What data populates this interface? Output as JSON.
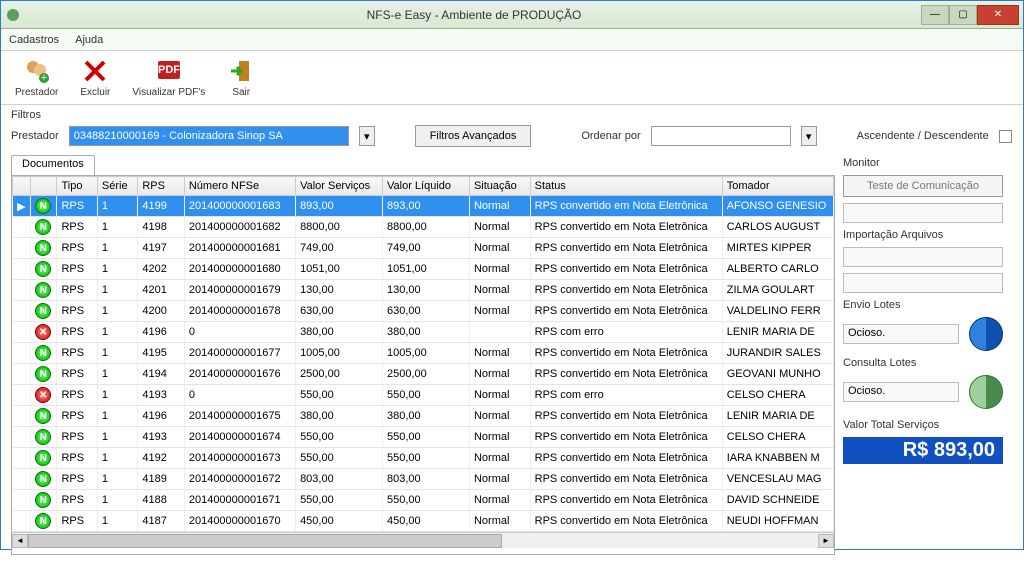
{
  "window": {
    "title": "NFS-e Easy - Ambiente de PRODUÇÃO"
  },
  "menu": {
    "cadastros": "Cadastros",
    "ajuda": "Ajuda"
  },
  "toolbar": {
    "prestador": "Prestador",
    "excluir": "Excluir",
    "visualizar": "Visualizar PDF's",
    "sair": "Sair"
  },
  "filtros": {
    "section": "Filtros",
    "prestador_label": "Prestador",
    "prestador_value": "03488210000169 - Colonizadora Sinop SA",
    "avancados": "Filtros Avançados",
    "ordenar_label": "Ordenar por",
    "asc_desc": "Ascendente / Descendente"
  },
  "tabs": {
    "documentos": "Documentos"
  },
  "columns": {
    "c0": "",
    "c1": "",
    "c2": "Tipo",
    "c3": "Série",
    "c4": "RPS",
    "c5": "Número NFSe",
    "c6": "Valor Serviços",
    "c7": "Valor Líquido",
    "c8": "Situação",
    "c9": "Status",
    "c10": "Tomador"
  },
  "rows": [
    {
      "ok": true,
      "tipo": "RPS",
      "serie": "1",
      "rps": "4199",
      "nfse": "201400000001683",
      "vs": "893,00",
      "vl": "893,00",
      "sit": "Normal",
      "status": "RPS convertido em Nota Eletrônica",
      "tom": "AFONSO GENESIO"
    },
    {
      "ok": true,
      "tipo": "RPS",
      "serie": "1",
      "rps": "4198",
      "nfse": "201400000001682",
      "vs": "8800,00",
      "vl": "8800,00",
      "sit": "Normal",
      "status": "RPS convertido em Nota Eletrônica",
      "tom": "CARLOS AUGUST"
    },
    {
      "ok": true,
      "tipo": "RPS",
      "serie": "1",
      "rps": "4197",
      "nfse": "201400000001681",
      "vs": "749,00",
      "vl": "749,00",
      "sit": "Normal",
      "status": "RPS convertido em Nota Eletrônica",
      "tom": "MIRTES KIPPER"
    },
    {
      "ok": true,
      "tipo": "RPS",
      "serie": "1",
      "rps": "4202",
      "nfse": "201400000001680",
      "vs": "1051,00",
      "vl": "1051,00",
      "sit": "Normal",
      "status": "RPS convertido em Nota Eletrônica",
      "tom": "ALBERTO CARLO"
    },
    {
      "ok": true,
      "tipo": "RPS",
      "serie": "1",
      "rps": "4201",
      "nfse": "201400000001679",
      "vs": "130,00",
      "vl": "130,00",
      "sit": "Normal",
      "status": "RPS convertido em Nota Eletrônica",
      "tom": "ZILMA GOULART"
    },
    {
      "ok": true,
      "tipo": "RPS",
      "serie": "1",
      "rps": "4200",
      "nfse": "201400000001678",
      "vs": "630,00",
      "vl": "630,00",
      "sit": "Normal",
      "status": "RPS convertido em Nota Eletrônica",
      "tom": "VALDELINO FERR"
    },
    {
      "ok": false,
      "tipo": "RPS",
      "serie": "1",
      "rps": "4196",
      "nfse": "0",
      "vs": "380,00",
      "vl": "380,00",
      "sit": "",
      "status": "RPS com erro",
      "tom": "LENIR MARIA DE"
    },
    {
      "ok": true,
      "tipo": "RPS",
      "serie": "1",
      "rps": "4195",
      "nfse": "201400000001677",
      "vs": "1005,00",
      "vl": "1005,00",
      "sit": "Normal",
      "status": "RPS convertido em Nota Eletrônica",
      "tom": "JURANDIR SALES"
    },
    {
      "ok": true,
      "tipo": "RPS",
      "serie": "1",
      "rps": "4194",
      "nfse": "201400000001676",
      "vs": "2500,00",
      "vl": "2500,00",
      "sit": "Normal",
      "status": "RPS convertido em Nota Eletrônica",
      "tom": "GEOVANI MUNHO"
    },
    {
      "ok": false,
      "tipo": "RPS",
      "serie": "1",
      "rps": "4193",
      "nfse": "0",
      "vs": "550,00",
      "vl": "550,00",
      "sit": "Normal",
      "status": "RPS com erro",
      "tom": "CELSO CHERA"
    },
    {
      "ok": true,
      "tipo": "RPS",
      "serie": "1",
      "rps": "4196",
      "nfse": "201400000001675",
      "vs": "380,00",
      "vl": "380,00",
      "sit": "Normal",
      "status": "RPS convertido em Nota Eletrônica",
      "tom": "LENIR MARIA DE"
    },
    {
      "ok": true,
      "tipo": "RPS",
      "serie": "1",
      "rps": "4193",
      "nfse": "201400000001674",
      "vs": "550,00",
      "vl": "550,00",
      "sit": "Normal",
      "status": "RPS convertido em Nota Eletrônica",
      "tom": "CELSO CHERA"
    },
    {
      "ok": true,
      "tipo": "RPS",
      "serie": "1",
      "rps": "4192",
      "nfse": "201400000001673",
      "vs": "550,00",
      "vl": "550,00",
      "sit": "Normal",
      "status": "RPS convertido em Nota Eletrônica",
      "tom": "IARA KNABBEN M"
    },
    {
      "ok": true,
      "tipo": "RPS",
      "serie": "1",
      "rps": "4189",
      "nfse": "201400000001672",
      "vs": "803,00",
      "vl": "803,00",
      "sit": "Normal",
      "status": "RPS convertido em Nota Eletrônica",
      "tom": "VENCESLAU MAG"
    },
    {
      "ok": true,
      "tipo": "RPS",
      "serie": "1",
      "rps": "4188",
      "nfse": "201400000001671",
      "vs": "550,00",
      "vl": "550,00",
      "sit": "Normal",
      "status": "RPS convertido em Nota Eletrônica",
      "tom": "DAVID SCHNEIDE"
    },
    {
      "ok": true,
      "tipo": "RPS",
      "serie": "1",
      "rps": "4187",
      "nfse": "201400000001670",
      "vs": "450,00",
      "vl": "450,00",
      "sit": "Normal",
      "status": "RPS convertido em Nota Eletrônica",
      "tom": "NEUDI HOFFMAN"
    }
  ],
  "monitor": {
    "label": "Monitor",
    "teste": "Teste  de Comunicação",
    "importacao": "Importação Arquivos",
    "envio": "Envio Lotes",
    "envio_status": "Ocioso.",
    "consulta": "Consulta Lotes",
    "consulta_status": "Ocioso.",
    "total_label": "Valor Total Serviços",
    "total_value": "R$ 893,00"
  }
}
